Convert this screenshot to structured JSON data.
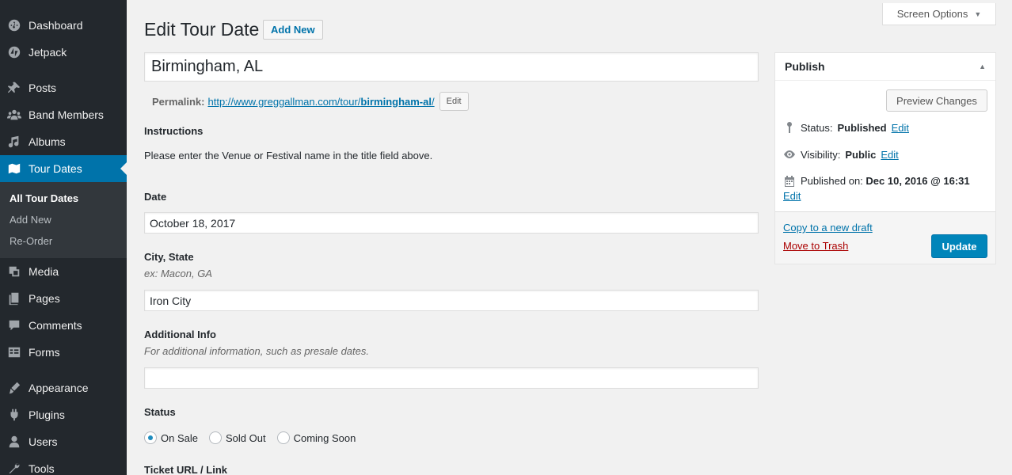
{
  "sidebar": {
    "items": [
      {
        "label": "Dashboard",
        "icon": "dashboard-icon"
      },
      {
        "label": "Jetpack",
        "icon": "jetpack-icon"
      },
      {
        "label": "Posts",
        "icon": "pin-icon"
      },
      {
        "label": "Band Members",
        "icon": "groups-icon"
      },
      {
        "label": "Albums",
        "icon": "music-note-icon"
      },
      {
        "label": "Tour Dates",
        "icon": "map-icon"
      },
      {
        "label": "Media",
        "icon": "media-icon"
      },
      {
        "label": "Pages",
        "icon": "pages-icon"
      },
      {
        "label": "Comments",
        "icon": "comment-icon"
      },
      {
        "label": "Forms",
        "icon": "forms-icon"
      },
      {
        "label": "Appearance",
        "icon": "brush-icon"
      },
      {
        "label": "Plugins",
        "icon": "plug-icon"
      },
      {
        "label": "Users",
        "icon": "user-icon"
      },
      {
        "label": "Tools",
        "icon": "wrench-icon"
      }
    ],
    "submenu": [
      "All Tour Dates",
      "Add New",
      "Re-Order"
    ]
  },
  "header": {
    "screen_options": "Screen Options",
    "title": "Edit Tour Date",
    "add_new": "Add New"
  },
  "post": {
    "title_value": "Birmingham, AL",
    "permalink_label": "Permalink:",
    "permalink_base": "http://www.greggallman.com/tour/",
    "permalink_slug": "birmingham-al",
    "permalink_tail": "/",
    "permalink_edit": "Edit"
  },
  "fields": {
    "instructions_label": "Instructions",
    "instructions_text": "Please enter the Venue or Festival name in the title field above.",
    "date_label": "Date",
    "date_value": "October 18, 2017",
    "city_label": "City, State",
    "city_desc": "ex: Macon, GA",
    "city_value": "Iron City",
    "info_label": "Additional Info",
    "info_desc": "For additional information, such as presale dates.",
    "info_value": "",
    "status_label": "Status",
    "status_options": [
      "On Sale",
      "Sold Out",
      "Coming Soon"
    ],
    "status_selected": "On Sale",
    "ticket_label": "Ticket URL / Link"
  },
  "publish": {
    "title": "Publish",
    "preview": "Preview Changes",
    "status_label": "Status:",
    "status_value": "Published",
    "visibility_label": "Visibility:",
    "visibility_value": "Public",
    "published_label": "Published on:",
    "published_value": "Dec 10, 2016 @ 16:31",
    "edit": "Edit",
    "copy_draft": "Copy to a new draft",
    "trash": "Move to Trash",
    "update": "Update"
  },
  "colors": {
    "sidebar_bg": "#23282d",
    "active_bg": "#0073aa",
    "link": "#0073aa",
    "primary_button": "#0085ba",
    "trash": "#a00"
  }
}
